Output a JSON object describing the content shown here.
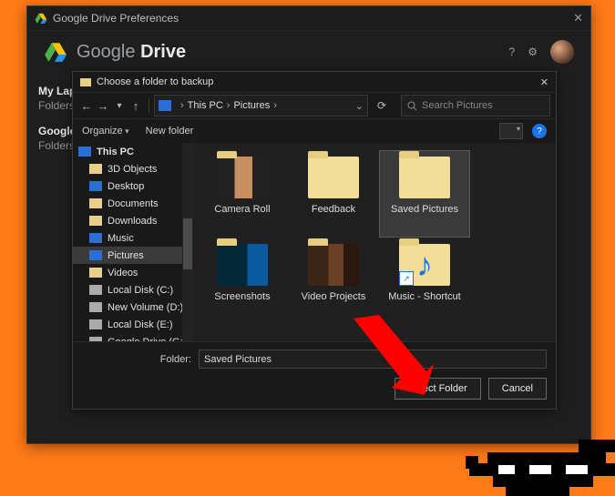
{
  "prefs": {
    "title": "Google Drive Preferences",
    "brand_a": "Google",
    "brand_b": "Drive",
    "side": [
      {
        "h": "My Laptop",
        "s": "Folders"
      },
      {
        "h": "Google",
        "s": "Folders"
      }
    ]
  },
  "picker": {
    "title": "Choose a folder to backup",
    "breadcrumbs": [
      "This PC",
      "Pictures"
    ],
    "search_placeholder": "Search Pictures",
    "organize": "Organize",
    "new_folder": "New folder",
    "tree": {
      "root": "This PC",
      "items": [
        {
          "icon": "fld",
          "label": "3D Objects"
        },
        {
          "icon": "dk",
          "label": "Desktop"
        },
        {
          "icon": "fld",
          "label": "Documents"
        },
        {
          "icon": "fld",
          "label": "Downloads"
        },
        {
          "icon": "mu",
          "label": "Music"
        },
        {
          "icon": "dk",
          "label": "Pictures",
          "selected": true
        },
        {
          "icon": "fld",
          "label": "Videos"
        },
        {
          "icon": "hd",
          "label": "Local Disk (C:)"
        },
        {
          "icon": "hd",
          "label": "New Volume (D:)"
        },
        {
          "icon": "hd",
          "label": "Local Disk (E:)"
        },
        {
          "icon": "hd",
          "label": "Google Drive (G:)"
        }
      ]
    },
    "grid": [
      {
        "label": "Camera Roll",
        "cls": "cam"
      },
      {
        "label": "Feedback",
        "cls": ""
      },
      {
        "label": "Saved Pictures",
        "cls": "",
        "selected": true
      },
      {
        "label": "Screenshots",
        "cls": "shot"
      },
      {
        "label": "Video Projects",
        "cls": "vid"
      },
      {
        "label": "Music - Shortcut",
        "cls": "music"
      }
    ],
    "folder_label": "Folder:",
    "folder_value": "Saved Pictures",
    "select_btn": "Select Folder",
    "cancel_btn": "Cancel"
  }
}
